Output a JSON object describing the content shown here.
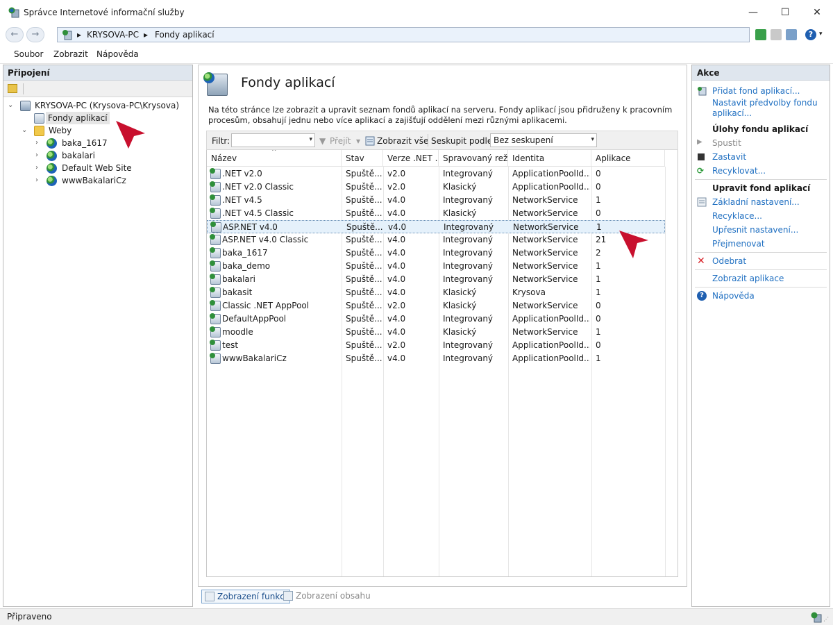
{
  "window": {
    "title": "Správce Internetové informační služby",
    "minimize": "—",
    "maximize": "☐",
    "close": "✕"
  },
  "address": {
    "crumbs": [
      "KRYSOVA-PC",
      "Fondy aplikací"
    ],
    "separator": "▸"
  },
  "menu": [
    "Soubor",
    "Zobrazit",
    "Nápověda"
  ],
  "connections": {
    "header": "Připojení",
    "server": "KRYSOVA-PC (Krysova-PC\\Krysova)",
    "app_pools": "Fondy aplikací",
    "sites": "Weby",
    "site_items": [
      "baka_1617",
      "bakalari",
      "Default Web Site",
      "wwwBakalariCz"
    ]
  },
  "center": {
    "title": "Fondy aplikací",
    "description": "Na této stránce lze zobrazit a upravit seznam fondů aplikací na serveru. Fondy aplikací jsou přidruženy k pracovním procesům, obsahují jednu nebo více aplikací a zajišťují oddělení mezi různými aplikacemi.",
    "filter_label": "Filtr:",
    "filter_value": "",
    "go_label": "Přejít",
    "show_all_label": "Zobrazit vše",
    "group_label": "Seskupit podle:",
    "group_value": "Bez seskupení",
    "columns": [
      "Název",
      "Stav",
      "Verze .NET ...",
      "Spravovaný rež...",
      "Identita",
      "Aplikace"
    ],
    "rows": [
      [
        ".NET v2.0",
        "Spuště...",
        "v2.0",
        "Integrovaný",
        "ApplicationPoolId...",
        "0"
      ],
      [
        ".NET v2.0 Classic",
        "Spuště...",
        "v2.0",
        "Klasický",
        "ApplicationPoolId...",
        "0"
      ],
      [
        ".NET v4.5",
        "Spuště...",
        "v4.0",
        "Integrovaný",
        "NetworkService",
        "1"
      ],
      [
        ".NET v4.5 Classic",
        "Spuště...",
        "v4.0",
        "Klasický",
        "NetworkService",
        "0"
      ],
      [
        "ASP.NET v4.0",
        "Spuště...",
        "v4.0",
        "Integrovaný",
        "NetworkService",
        "1"
      ],
      [
        "ASP.NET v4.0 Classic",
        "Spuště...",
        "v4.0",
        "Integrovaný",
        "NetworkService",
        "21"
      ],
      [
        "baka_1617",
        "Spuště...",
        "v4.0",
        "Integrovaný",
        "NetworkService",
        "2"
      ],
      [
        "baka_demo",
        "Spuště...",
        "v4.0",
        "Integrovaný",
        "NetworkService",
        "1"
      ],
      [
        "bakalari",
        "Spuště...",
        "v4.0",
        "Integrovaný",
        "NetworkService",
        "1"
      ],
      [
        "bakasit",
        "Spuště...",
        "v4.0",
        "Klasický",
        "Krysova",
        "1"
      ],
      [
        "Classic .NET AppPool",
        "Spuště...",
        "v2.0",
        "Klasický",
        "NetworkService",
        "0"
      ],
      [
        "DefaultAppPool",
        "Spuště...",
        "v4.0",
        "Integrovaný",
        "ApplicationPoolId...",
        "0"
      ],
      [
        "moodle",
        "Spuště...",
        "v4.0",
        "Klasický",
        "NetworkService",
        "1"
      ],
      [
        "test",
        "Spuště...",
        "v2.0",
        "Integrovaný",
        "ApplicationPoolId...",
        "0"
      ],
      [
        "wwwBakalariCz",
        "Spuště...",
        "v4.0",
        "Integrovaný",
        "ApplicationPoolId...",
        "1"
      ]
    ],
    "selected_row": 4
  },
  "bottom_tabs": [
    "Zobrazení funkcí",
    "Zobrazení obsahu"
  ],
  "actions": {
    "header": "Akce",
    "add_pool": "Přidat fond aplikací...",
    "set_defaults": "Nastavit předvolby fondu aplikací...",
    "pool_tasks_head": "Úlohy fondu aplikací",
    "start": "Spustit",
    "stop": "Zastavit",
    "recycle": "Recyklovat...",
    "edit_head": "Upravit fond aplikací",
    "basic_settings": "Základní nastavení...",
    "recycling": "Recyklace...",
    "advanced_settings": "Upřesnit nastavení...",
    "rename": "Přejmenovat",
    "remove": "Odebrat",
    "view_apps": "Zobrazit aplikace",
    "help": "Nápověda"
  },
  "status": {
    "text": "Připraveno"
  },
  "colors": {
    "accent": "#1f6fc1",
    "panel_header": "#dfe6ee",
    "annotation_arrow": "#c8102e"
  }
}
